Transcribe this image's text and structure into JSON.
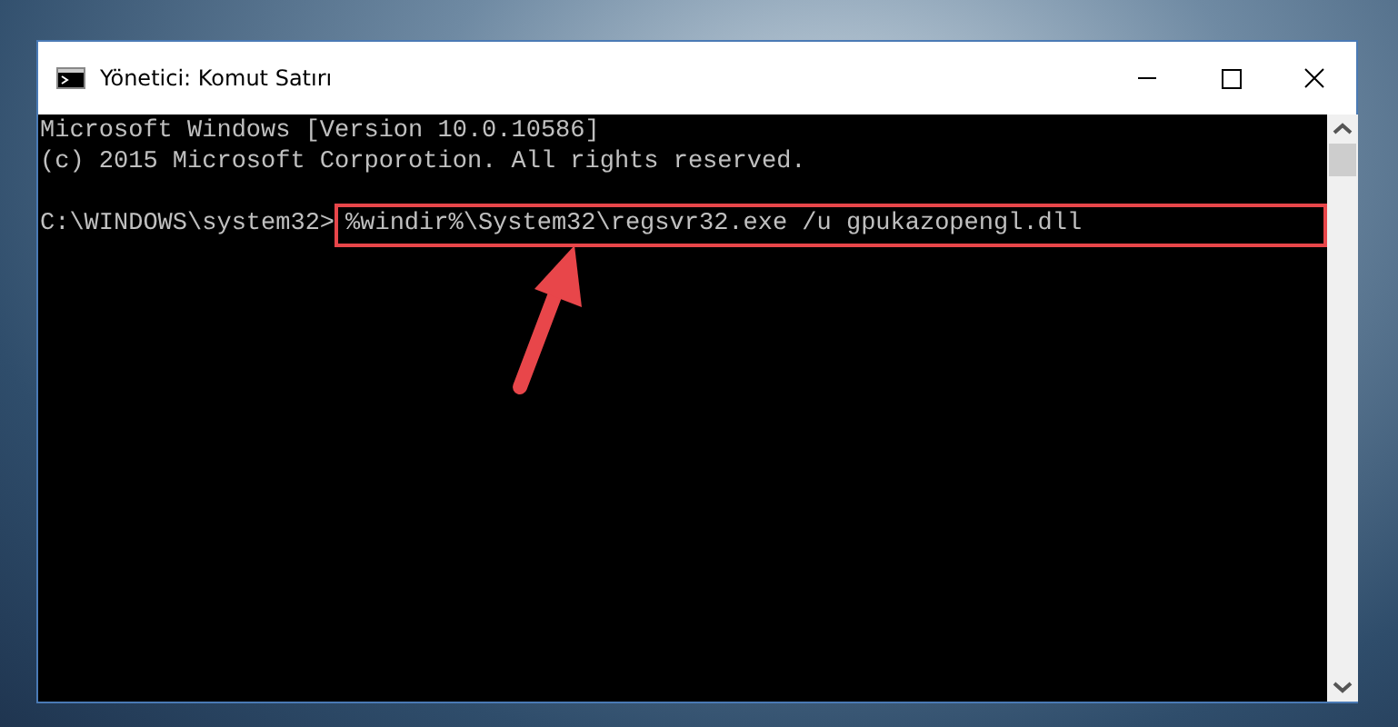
{
  "window": {
    "title": "Yönetici: Komut Satırı"
  },
  "console": {
    "lines": [
      "Microsoft Windows [Version 10.0.10586]",
      "(c) 2015 Microsoft Corporotion. All rights reserved."
    ],
    "prompt": "C:\\WINDOWS\\system32>",
    "command": "%windir%\\System32\\regsvr32.exe /u gpukazopengl.dll"
  }
}
